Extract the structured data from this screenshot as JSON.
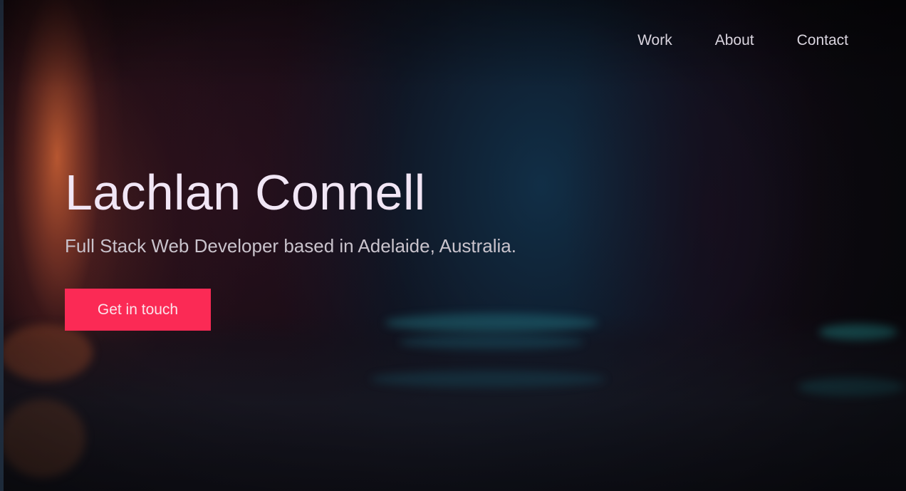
{
  "nav": {
    "items": [
      {
        "label": "Work"
      },
      {
        "label": "About"
      },
      {
        "label": "Contact"
      }
    ]
  },
  "hero": {
    "title": "Lachlan Connell",
    "subtitle": "Full Stack Web Developer based in Adelaide, Australia.",
    "cta_label": "Get in touch"
  },
  "colors": {
    "accent": "#fb2a55",
    "title_text": "#f1e6f5",
    "body_text": "#c9c3cc",
    "nav_text": "#d9d4de"
  }
}
